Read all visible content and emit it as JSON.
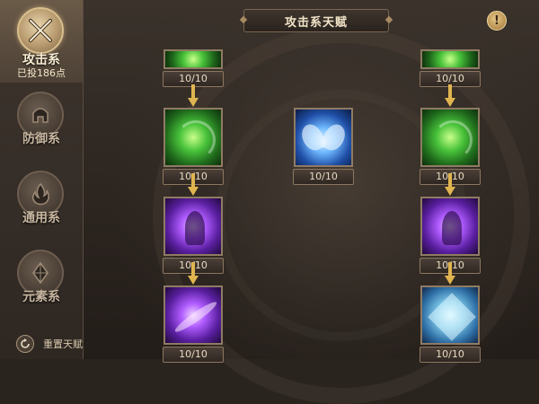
{
  "header": {
    "title": "攻击系天赋",
    "info_icon": "exclamation-icon",
    "info_glyph": "!"
  },
  "sidebar": {
    "categories": [
      {
        "name": "攻击系",
        "points": "已投186点",
        "icon": "crossed-swords-icon",
        "active": true
      },
      {
        "name": "防御系",
        "icon": "helmet-icon",
        "active": false
      },
      {
        "name": "通用系",
        "icon": "flame-icon",
        "active": false
      },
      {
        "name": "元素系",
        "icon": "crystal-icon",
        "active": false
      }
    ],
    "reset_label": "重置天赋",
    "reset_icon": "refresh-icon"
  },
  "talents": {
    "left_top": {
      "count": "10/10",
      "icon": "green-energy-icon"
    },
    "right_top": {
      "count": "10/10",
      "icon": "green-energy-icon"
    },
    "left_1": {
      "count": "10/10",
      "icon": "green-swirl-icon"
    },
    "middle": {
      "count": "10/10",
      "icon": "blue-wings-icon"
    },
    "right_1": {
      "count": "10/10",
      "icon": "green-fist-icon"
    },
    "left_2": {
      "count": "10/10",
      "icon": "purple-figure-icon"
    },
    "right_2": {
      "count": "10/10",
      "icon": "purple-demon-icon"
    },
    "left_3": {
      "count": "10/10",
      "icon": "purple-slash-icon"
    },
    "right_3": {
      "count": "10/10",
      "icon": "ice-crystal-icon"
    }
  },
  "colors": {
    "accent_gold": "#e0b550",
    "panel_dark": "#2a241f",
    "text_light": "#f1e4c8"
  }
}
